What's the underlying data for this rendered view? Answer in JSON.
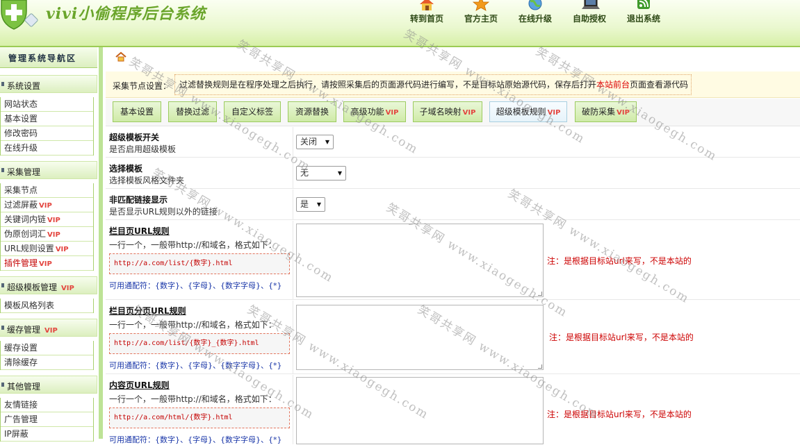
{
  "header": {
    "app_title": "vivi小偷程序后台系统",
    "nav": [
      {
        "label": "转到首页",
        "icon": "home-icon"
      },
      {
        "label": "官方主页",
        "icon": "star-icon"
      },
      {
        "label": "在线升级",
        "icon": "globe-icon"
      },
      {
        "label": "自助授权",
        "icon": "laptop-icon"
      },
      {
        "label": "退出系统",
        "icon": "rss-exit-icon"
      }
    ]
  },
  "sidebar": {
    "title": "管理系统导航区",
    "groups": [
      {
        "label": "系统设置",
        "vip": "",
        "items": [
          {
            "label": "网站状态",
            "vip": ""
          },
          {
            "label": "基本设置",
            "vip": ""
          },
          {
            "label": "修改密码",
            "vip": ""
          },
          {
            "label": "在线升级",
            "vip": ""
          }
        ]
      },
      {
        "label": "采集管理",
        "vip": "",
        "items": [
          {
            "label": "采集节点",
            "vip": ""
          },
          {
            "label": "过滤屏蔽",
            "vip": "VIP"
          },
          {
            "label": "关键词内链",
            "vip": "VIP"
          },
          {
            "label": "伪原创词汇",
            "vip": "VIP"
          },
          {
            "label": "URL规则设置",
            "vip": "VIP"
          },
          {
            "label": "插件管理",
            "vip": "VIP"
          }
        ]
      },
      {
        "label": "超级模板管理",
        "vip": "VIP",
        "items": [
          {
            "label": "模板风格列表",
            "vip": ""
          }
        ]
      },
      {
        "label": "缓存管理",
        "vip": "VIP",
        "items": [
          {
            "label": "缓存设置",
            "vip": ""
          },
          {
            "label": "清除缓存",
            "vip": ""
          }
        ]
      },
      {
        "label": "其他管理",
        "vip": "",
        "items": [
          {
            "label": "友情链接",
            "vip": ""
          },
          {
            "label": "广告管理",
            "vip": ""
          },
          {
            "label": "IP屏蔽",
            "vip": ""
          }
        ]
      }
    ]
  },
  "main": {
    "node_label": "采集节点设置：",
    "node_tip_before": "过滤替换规则是在程序处理之后执行，请按照采集后的页面源代码进行编写，不是目标站原始源代码，保存后打开",
    "node_tip_link": "本站前台",
    "node_tip_after": "页面查看源代码",
    "tabs": [
      {
        "label": "基本设置",
        "vip": ""
      },
      {
        "label": "替换过滤",
        "vip": ""
      },
      {
        "label": "自定义标签",
        "vip": ""
      },
      {
        "label": "资源替换",
        "vip": ""
      },
      {
        "label": "高级功能",
        "vip": "VIP"
      },
      {
        "label": "子域名映射",
        "vip": "VIP"
      },
      {
        "label": "超级模板规则",
        "vip": "VIP"
      },
      {
        "label": "破防采集",
        "vip": "VIP"
      }
    ],
    "active_tab": "超级模板规则",
    "fields": [
      {
        "title": "超级模板开关",
        "desc": "是否启用超级模板",
        "value": "关闭"
      },
      {
        "title": "选择模板",
        "desc": "选择模板风格文件夹",
        "value": "无"
      },
      {
        "title": "非匹配链接显示",
        "desc": "是否显示URL规则以外的链接",
        "value": "是"
      }
    ],
    "rules": [
      {
        "title": "栏目页URL规则",
        "desc": "一行一个，一般带http://和域名，格式如下：",
        "example": "http://a.com/list/{数字}.html",
        "wildcards": "可用通配符：{数字}、{字母}、{数字字母}、{*}",
        "value": "",
        "note": "注：是根据目标站url来写，不是本站的"
      },
      {
        "title": "栏目页分页URL规则",
        "desc": "一行一个，一般带http://和域名，格式如下：",
        "example": "http://a.com/list/{数字}_{数字}.html",
        "wildcards": "可用通配符：{数字}、{字母}、{数字字母}、{*}",
        "value": "",
        "note": "注：是根据目标站url来写，不是本站的"
      },
      {
        "title": "内容页URL规则",
        "desc": "一行一个，一般带http://和域名，格式如下：",
        "example": "http://a.com/html/{数字}.html",
        "wildcards": "可用通配符：{数字}、{字母}、{数字字母}、{*}",
        "value": "",
        "note": "注：是根据目标站url来写，不是本站的"
      }
    ]
  },
  "watermark": "笑哥共享网 www.xiaogegh.com",
  "colors": {
    "accent_green": "#9ccc54",
    "vip_red": "#e3453f",
    "note_red": "#cc0000",
    "wildcard_blue": "#1936a8"
  }
}
